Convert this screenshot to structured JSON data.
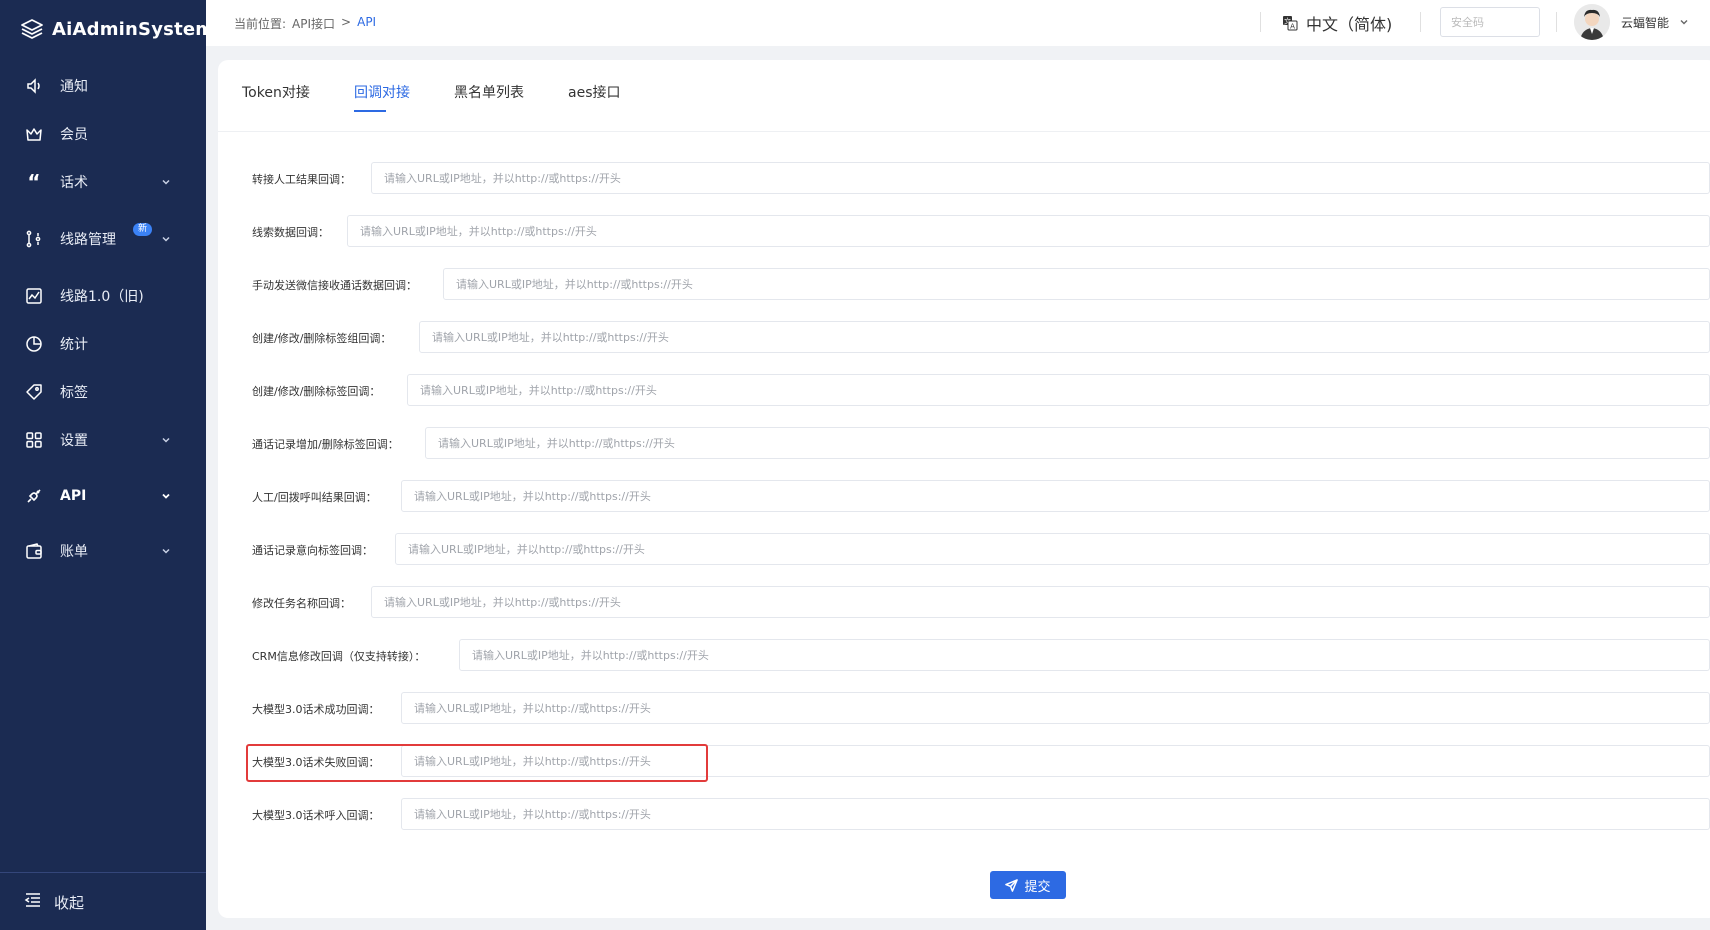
{
  "app": {
    "title": "AiAdminSystem"
  },
  "sidebar": {
    "items": [
      {
        "label": "通知",
        "icon": "speaker-icon"
      },
      {
        "label": "会员",
        "icon": "crown-icon"
      },
      {
        "label": "话术",
        "icon": "quote-icon",
        "expandable": true
      },
      {
        "label": "线路管理",
        "icon": "route-icon",
        "expandable": true,
        "badge": "新"
      },
      {
        "label": "线路1.0（旧)",
        "icon": "chart-box-icon"
      },
      {
        "label": "统计",
        "icon": "pie-icon"
      },
      {
        "label": "标签",
        "icon": "tag-icon"
      },
      {
        "label": "设置",
        "icon": "grid-icon",
        "expandable": true
      },
      {
        "label": "API",
        "icon": "plug-icon",
        "expandable": true,
        "active": true
      },
      {
        "label": "账单",
        "icon": "wallet-icon",
        "expandable": true
      }
    ],
    "collapse_label": "收起"
  },
  "header": {
    "breadcrumb_prefix": "当前位置:",
    "breadcrumb_parent": "API接口",
    "breadcrumb_sep": ">",
    "breadcrumb_current": "API",
    "language": "中文（简体)",
    "security_code_placeholder": "安全码",
    "user_name": "云蝠智能"
  },
  "tabs": [
    {
      "label": "Token对接",
      "active": false
    },
    {
      "label": "回调对接",
      "active": true
    },
    {
      "label": "黑名单列表",
      "active": false
    },
    {
      "label": "aes接口",
      "active": false
    }
  ],
  "form": {
    "placeholder": "请输入URL或IP地址，并以http://或https://开头",
    "fields": [
      {
        "label": "转接人工结果回调：",
        "value": ""
      },
      {
        "label": "线索数据回调：",
        "value": ""
      },
      {
        "label": "手动发送微信接收通话数据回调：",
        "value": ""
      },
      {
        "label": "创建/修改/删除标签组回调：",
        "value": ""
      },
      {
        "label": "创建/修改/删除标签回调：",
        "value": ""
      },
      {
        "label": "通话记录增加/删除标签回调：",
        "value": ""
      },
      {
        "label": "人工/回拨呼叫结果回调：",
        "value": ""
      },
      {
        "label": "通话记录意向标签回调：",
        "value": ""
      },
      {
        "label": "修改任务名称回调：",
        "value": ""
      },
      {
        "label": "CRM信息修改回调（仅支持转接）：",
        "value": ""
      },
      {
        "label": "大模型3.0话术成功回调：",
        "value": ""
      },
      {
        "label": "大模型3.0话术失败回调：",
        "value": ""
      },
      {
        "label": "大模型3.0话术呼入回调：",
        "value": ""
      }
    ],
    "submit_label": "提交"
  },
  "colors": {
    "sidebar_bg": "#1b2b52",
    "accent": "#2d6ae3",
    "highlight": "#e23b3b"
  }
}
